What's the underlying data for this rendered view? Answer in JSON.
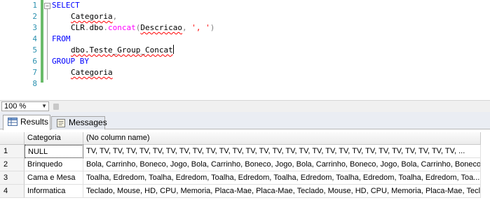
{
  "editor": {
    "line_numbers": [
      "1",
      "2",
      "3",
      "4",
      "5",
      "6",
      "7",
      "8"
    ],
    "lines": {
      "l1_kw": "SELECT",
      "l2_ident": "Categoria",
      "l2_punct": ",",
      "l3_ident": "CLR",
      "l3_dot1": ".",
      "l3_schema": "dbo",
      "l3_dot2": ".",
      "l3_fn": "concat",
      "l3_open": "(",
      "l3_arg": "Descricao",
      "l3_comma": ", ",
      "l3_str": "', '",
      "l3_close": ")",
      "l4_kw": "FROM",
      "l5_table": "dbo.Teste_Group_Concat",
      "l6_kw": "GROUP BY",
      "l7_ident": "Categoria"
    },
    "collapse_symbol": "−"
  },
  "zoom": {
    "value": "100 %"
  },
  "tabs": {
    "results": "Results",
    "messages": "Messages"
  },
  "grid": {
    "headers": {
      "col1": "Categoria",
      "col2": "(No column name)"
    },
    "rows": [
      {
        "num": "1",
        "categoria": "NULL",
        "value": "TV, TV, TV, TV, TV, TV, TV, TV, TV, TV, TV, TV, TV, TV, TV, TV, TV, TV, TV, TV, TV, TV, TV, TV, TV, TV, TV, TV, ..."
      },
      {
        "num": "2",
        "categoria": "Brinquedo",
        "value": "Bola, Carrinho, Boneco, Jogo, Bola, Carrinho, Boneco, Jogo, Bola, Carrinho, Boneco, Jogo, Bola, Carrinho, Boneco..."
      },
      {
        "num": "3",
        "categoria": "Cama e Mesa",
        "value": "Toalha, Edredom, Toalha, Edredom, Toalha, Edredom, Toalha, Edredom, Toalha, Edredom, Toalha, Edredom, Toa..."
      },
      {
        "num": "4",
        "categoria": "Informatica",
        "value": "Teclado, Mouse, HD, CPU, Memoria, Placa-Mae, Placa-Mae, Teclado, Mouse, HD, CPU, Memoria, Placa-Mae, Tecl..."
      }
    ]
  },
  "colors": {
    "keyword": "#0000ff",
    "function": "#ff00ff",
    "string": "#ff0000",
    "line_number": "#2b91af",
    "change_bar": "#6abb6a"
  }
}
